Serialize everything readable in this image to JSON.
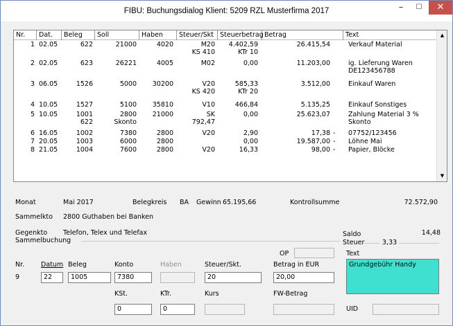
{
  "window": {
    "title": "FIBU: Buchungsdialog Klient: 5209  RZL Musterfirma  2017",
    "min_icon": "–",
    "max_icon": "☐",
    "close_icon": "✕"
  },
  "grid": {
    "headers": [
      "Nr.",
      "Dat.",
      "Beleg",
      "Soll",
      "Haben",
      "Steuer/Skt",
      "Steuerbetrag",
      "Betrag",
      "Text"
    ],
    "rows": [
      {
        "nr": "1",
        "dat": "02.05",
        "beleg": "622",
        "soll": "21000",
        "haben": "4020",
        "steuer": "M20",
        "steuer2": "KS 410",
        "steuerbetrag": "4.402,59",
        "steuerbetrag2": "KTr 10",
        "betrag": "26.415,54",
        "sign": "",
        "text": "Verkauf Material",
        "text2": ""
      },
      {
        "nr": "2",
        "dat": "02.05",
        "beleg": "623",
        "soll": "26221",
        "haben": "4005",
        "steuer": "M02",
        "steuer2": "",
        "steuerbetrag": "0,00",
        "steuerbetrag2": "",
        "betrag": "11.203,00",
        "sign": "",
        "text": "ig. Lieferung Waren",
        "text2": "DE123456788"
      },
      {
        "nr": "3",
        "dat": "06.05",
        "beleg": "1526",
        "soll": "5000",
        "haben": "30200",
        "steuer": "V20",
        "steuer2": "KS 420",
        "steuerbetrag": "585,33",
        "steuerbetrag2": "KTr 20",
        "betrag": "3.512,00",
        "sign": "",
        "text": "Einkauf Waren",
        "text2": ""
      },
      {
        "nr": "4",
        "dat": "10.05",
        "beleg": "1527",
        "soll": "5100",
        "haben": "35810",
        "steuer": "V10",
        "steuer2": "",
        "steuerbetrag": "466,84",
        "steuerbetrag2": "",
        "betrag": "5.135,25",
        "sign": "",
        "text": "Einkauf Sonstiges",
        "text2": ""
      },
      {
        "nr": "5",
        "dat": "10.05",
        "beleg": "1001",
        "beleg2": "622",
        "soll": "2800",
        "soll2": "Skonto",
        "haben": "21000",
        "steuer": "SK",
        "steuer2": "792,47",
        "steuerbetrag": "0,00",
        "steuerbetrag2": "",
        "betrag": "25.623,07",
        "sign": "",
        "text": "Zahlung Material 3 %",
        "text2": "Skonto"
      },
      {
        "nr": "6",
        "dat": "16.05",
        "beleg": "1002",
        "soll": "7380",
        "haben": "2800",
        "steuer": "V20",
        "steuer2": "",
        "steuerbetrag": "2,90",
        "steuerbetrag2": "",
        "betrag": "17,38",
        "sign": "-",
        "text": "07752/123456",
        "text2": ""
      },
      {
        "nr": "7",
        "dat": "20.05",
        "beleg": "1003",
        "soll": "6000",
        "haben": "2800",
        "steuer": "",
        "steuer2": "",
        "steuerbetrag": "0,00",
        "steuerbetrag2": "",
        "betrag": "19.587,00",
        "sign": "-",
        "text": "Löhne Mai",
        "text2": ""
      },
      {
        "nr": "8",
        "dat": "21.05",
        "beleg": "1004",
        "soll": "7600",
        "haben": "2800",
        "steuer": "V20",
        "steuer2": "",
        "steuerbetrag": "16,33",
        "steuerbetrag2": "",
        "betrag": "98,00",
        "sign": "-",
        "text": "Papier, Blöcke",
        "text2": ""
      }
    ],
    "scroll_up_icon": "▲",
    "scroll_down_icon": "▼"
  },
  "info": {
    "monat_label": "Monat",
    "monat_value": "Mai 2017",
    "belegkreis_label": "Belegkreis",
    "belegkreis_value": "BA",
    "gewinn_label": "Gewinn",
    "gewinn_value": "65.195,66",
    "kontrollsumme_label": "Kontrollsumme",
    "kontrollsumme_value": "72.572,90",
    "sammelkto_label": "Sammelkto",
    "sammelkto_value": "2800  Guthaben bei Banken",
    "gegenkto_label": "Gegenkto",
    "gegenkto_value": "Telefon, Telex und Telefax",
    "saldo_label": "Saldo",
    "saldo_value": "14,48",
    "steuer_label": "Steuer",
    "steuer_value": "3,33"
  },
  "form": {
    "group_label": "Sammelbuchung",
    "op_label": "OP",
    "nr_label": "Nr.",
    "nr_value": "9",
    "datum_label": "Datum",
    "beleg_label": "Beleg",
    "konto_label": "Konto",
    "haben_label": "Haben",
    "steuer_label": "Steuer/Skt.",
    "betrag_label": "Betrag in EUR",
    "text_label": "Text",
    "datum_value": "22",
    "beleg_value": "1005",
    "konto_value": "7380",
    "haben_value": "",
    "steuer_value": "20",
    "betrag_value": "20,00",
    "text_value": "Grundgebühr Handy",
    "kst_label": "KSt.",
    "ktr_label": "KTr.",
    "kurs_label": "Kurs",
    "fw_label": "FW-Betrag",
    "uid_label": "UID",
    "kst_value": "0",
    "ktr_value": "0",
    "kurs_value": "",
    "fw_value": "",
    "uid_value": ""
  },
  "colors": {
    "text_highlight": "#40e0d0",
    "close_button": "#c7504a"
  }
}
